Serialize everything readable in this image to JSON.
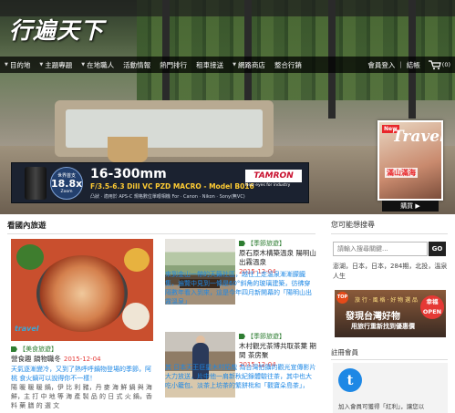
{
  "site": {
    "logo_text": "行遍天下"
  },
  "nav": {
    "items": [
      "目的地",
      "主題專題",
      "在地職人",
      "活動情報",
      "熱門排行",
      "租車接送",
      "網路商店",
      "整合行銷"
    ],
    "member_login": "會員登入",
    "separator": "|",
    "cart_label": "結帳",
    "cart_count": "(0)"
  },
  "ad": {
    "badge_top": "世界首支",
    "badge_value": "18.8x",
    "badge_unit": "Zoom",
    "headline": "16-300mm",
    "spec": "F/3.5-6.3 DiII VC PZD MACRO - Model B016",
    "small": "凸狀 · 適用於 APS-C 規格數位單眼相機     For · Canon · Nikon · Sony(無VC)",
    "brand": "TAMRON",
    "tagline": "New eyes for industry"
  },
  "magazine": {
    "badge": "New",
    "title": "Travel",
    "headline": "滿山滿海",
    "buy_label": "購買 ▶"
  },
  "main": {
    "section_title": "看國內旅遊",
    "featured": {
      "category": "【美食旅遊】",
      "title": "營食趣 鍋物職冬",
      "date": "2015-12-04",
      "teaser": "天氣逐漸變冷，又到了熱呼呼鍋物登場的季節，阿桃 食火鍋可以說得你不一樣！",
      "body": "陽 暖 暖 暖 鍋，伊 比 利 豬，丹 麥 海 鮮 鍋 與 海 鮮，主 打 中 地 等 海 產 製 品 的 日 式 火 鍋，香 料 藥 膳 的 選 文"
    },
    "articles": [
      {
        "category": "【季節旅遊】",
        "title": "原石原木構築溫泉 陽明山出霧溫泉",
        "date": "2015-12-04",
        "teaser": "來到金山一帶的天籟社區，越往上走溫泉漸漸朦朧集，遍覽中見到一條是60°斜角的玻璃建築，彷彿穿隔數年看入到來，這是今年四月新開幕的「陽明山出霧溫泉」"
      },
      {
        "category": "【季節旅遊】",
        "title": "木村觀光茶博共取茶葉 期間 茶房聚",
        "date": "2015-12-04",
        "teaser": "其 日本天王巨星木村拓哉 為台灣拍攝的觀光宣傳影片大力放送，片中他一肩新秋紀錄體驗往茶，其中也大吃小籠包、淡茶上坊茶的繁餅枇和「觀寶朵島茶」，"
      }
    ]
  },
  "sidebar": {
    "search_title": "您可能想搜尋",
    "search_placeholder": "請輸入搜尋關鍵...",
    "search_button": "GO",
    "hot_tags": "澎湖，日本，日本，284期，北投，溫泉人生",
    "promo": {
      "top_badge": "TOP",
      "line1": "旅 行 · 風 格 · 好 物 選 品",
      "line2": "發現台灣好物",
      "line3": "用旅行重新找到優惠價",
      "seal": "幸福 OPEN"
    },
    "member_title": "註冊會員",
    "member_logo": "t",
    "member_text": "加入會員可獲得「紅利」，讓您以"
  }
}
